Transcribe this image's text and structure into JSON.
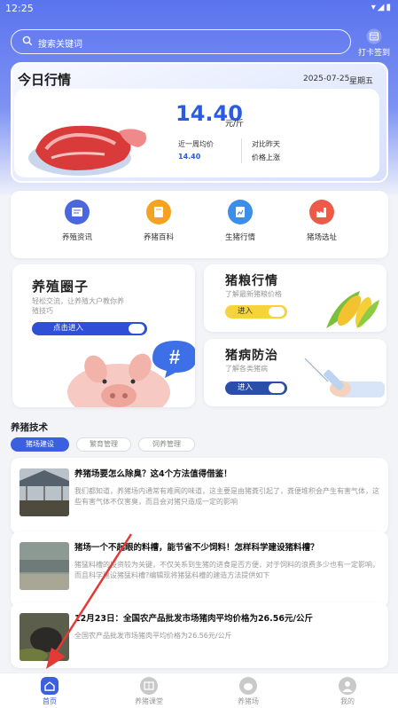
{
  "status_bar": {
    "time": "12:25"
  },
  "search": {
    "placeholder": "搜索关键词"
  },
  "checkin": {
    "label": "打卡签到"
  },
  "price": {
    "title": "今日行情",
    "date": "2025-07-25",
    "weekday": "星期五",
    "value": "14.40",
    "unit": "元/斤",
    "week_avg_label": "近一周均价",
    "week_avg_value": "14.40",
    "compare_label": "对比昨天",
    "compare_value": "价格上涨"
  },
  "quick": [
    {
      "label": "养殖资讯",
      "icon": "news-icon",
      "color": "#4a67e0"
    },
    {
      "label": "养猪百科",
      "icon": "book-icon",
      "color": "#f3a320"
    },
    {
      "label": "生猪行情",
      "icon": "chart-doc-icon",
      "color": "#3b8fe8"
    },
    {
      "label": "猪场选址",
      "icon": "factory-icon",
      "color": "#ec5a4a"
    }
  ],
  "promos": {
    "circle": {
      "title": "养殖圈子",
      "subtitle": "轻松交流，让养殖大户教你养殖技巧",
      "button": "点击进入"
    },
    "feed": {
      "title": "猪粮行情",
      "subtitle": "了解最新猪粮价格",
      "button": "进入"
    },
    "disease": {
      "title": "猪病防治",
      "subtitle": "了解各类猪病",
      "button": "进入"
    }
  },
  "tech": {
    "title": "养猪技术",
    "tabs": [
      "猪场建设",
      "繁育管理",
      "饲养管理"
    ]
  },
  "articles": [
    {
      "title": "养猪场要怎么除臭？这4个方法值得借鉴！",
      "desc": "我们都知道，养猪场内通常有难闻的味道，这主要是由猪粪引起了，粪便堆积会产生有害气体，这些有害气体不仅害臭，而且会对猪只造成一定的影响"
    },
    {
      "title": "猪场一个不起眼的料槽，能节省不少饲料！怎样科学建设猪料槽？",
      "desc": "猪猛料槽的投资较为关键，不仅关系到生猪的进食是否方便，对于饲料的浪费多少也有一定影响，而且科学建设猪猛料槽?编辑现将猪猛料槽的建造方法提供如下"
    },
    {
      "title": "12月23日：全国农产品批发市场猪肉平均价格为26.56元/公斤",
      "desc": "全国农产品批发市场猪肉平均价格为26.56元/公斤"
    }
  ],
  "tabbar": [
    {
      "label": "首页",
      "icon": "home-icon",
      "active": true
    },
    {
      "label": "养猪课堂",
      "icon": "classroom-icon",
      "active": false
    },
    {
      "label": "养猪场",
      "icon": "farm-icon",
      "active": false
    },
    {
      "label": "我的",
      "icon": "profile-icon",
      "active": false
    }
  ],
  "colors": {
    "primary": "#3c5fe0",
    "accent_yellow": "#f5d33a",
    "annotation_red": "#e53935"
  }
}
